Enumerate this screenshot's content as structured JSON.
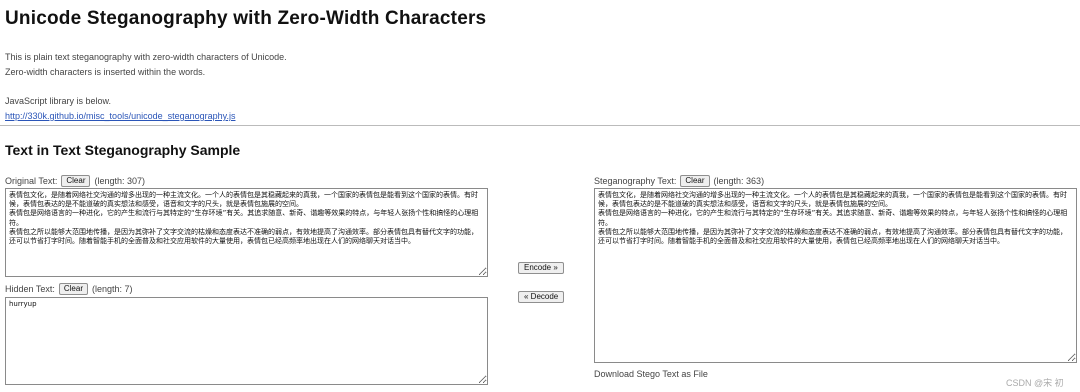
{
  "title": "Unicode Steganography with Zero-Width Characters",
  "intro": {
    "line1": "This is plain text steganography with zero-width characters of Unicode.",
    "line2": "Zero-width characters is inserted within the words."
  },
  "library": {
    "label": "JavaScript library is below.",
    "link": "http://330k.github.io/misc_tools/unicode_steganography.js"
  },
  "sample": {
    "heading": "Text in Text Steganography Sample",
    "original": {
      "label": "Original Text:",
      "clear": "Clear",
      "length": "(length: 307)",
      "text": "表情包文化，是随着网络社交沟通的增多出现的一种主流文化。一个人的表情包是其稳藏起来的真我，一个国家的表情包是能看到这个国家的表情。有时候，表情包表达的是不能道破的真实想法和感受，语音和文字的尺头，就是表情包施展的空间。\n表情包是网络语言的一种进化，它的产生和流行与其特定的“生存环境”有关。其追求随意、新奇、谐趣等效果的特点，与年轻人张扬个性和搞怪的心理相符。\n表情包之所以能够大范围地传播，是因为其弥补了文字交流的枯燥和态度表达不准确的弱点，有效地提高了沟通效率。部分表情包具有替代文字的功能，还可以节省打字时间。随着智能手机的全面普及和社交应用软件的大量使用，表情包已经高频率地出现在人们的网络聊天对话当中。"
    },
    "hidden": {
      "label": "Hidden Text:",
      "clear": "Clear",
      "length": "(length: 7)",
      "text": "hurryup"
    },
    "encode_label": "Encode »",
    "decode_label": "« Decode",
    "stego": {
      "label": "Steganography Text:",
      "clear": "Clear",
      "length": "(length: 363)",
      "text": "表情包文化，是随着网络社交沟通的增多出现的一种主流文化。一个人的表情包是其稳藏起来的真我，一个国家的表情包是能看到这个国家的表情。有时候，表情包表达的是不能道破的真实想法和感受，语音和文字的尺头，就是表情包施展的空间。\n表情包是网络语言的一种进化，它的产生和流行与其特定的“生存环境”有关。其追求随意、新奇、谐趣等效果的特点，与年轻人张扬个性和搞怪的心理相符。\n表情包之所以能够大范围地传播，是因为其弥补了文字交流的枯燥和态度表达不准确的弱点，有效地提高了沟通效率。部分表情包具有替代文字的功能，还可以节省打字时间。随着智能手机的全面普及和社交应用软件的大量使用，表情包已经高频率地出现在人们的网络聊天对话当中。"
    },
    "download_label": "Download Stego Text as File"
  },
  "watermark": "CSDN @宋 初"
}
